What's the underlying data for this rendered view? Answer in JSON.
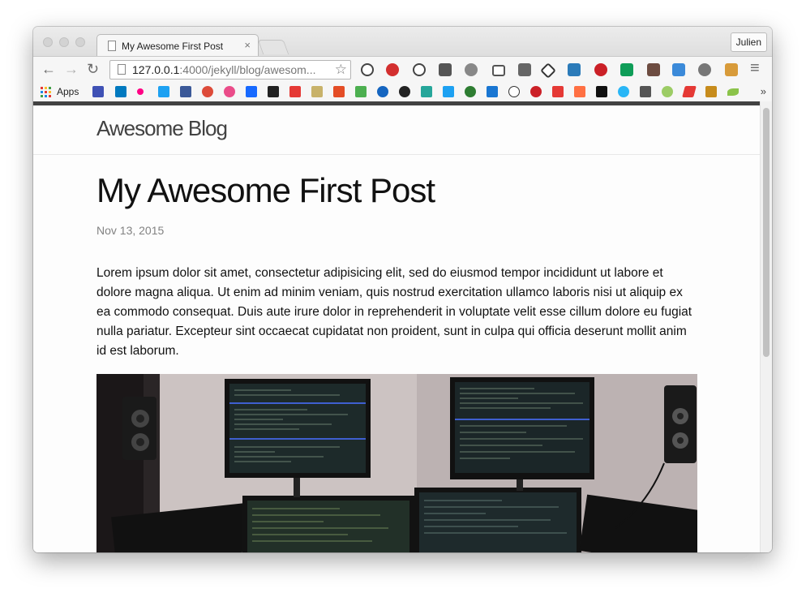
{
  "browser": {
    "tab_title": "My Awesome First Post",
    "tab_close": "×",
    "profile": "Julien",
    "url_host": "127.0.0.1",
    "url_rest": ":4000/jekyll/blog/awesom...",
    "back": "←",
    "forward": "→",
    "reload": "↻",
    "star": "☆",
    "menu": "≡",
    "bookmarks_apps": "Apps",
    "bookmarks_more": "»"
  },
  "page": {
    "site_title": "Awesome Blog",
    "post_title": "My Awesome First Post",
    "post_date": "Nov 13, 2015",
    "post_body": "Lorem ipsum dolor sit amet, consectetur adipisicing elit, sed do eiusmod tempor incididunt ut labore et dolore magna aliqua. Ut enim ad minim veniam, quis nostrud exercitation ullamco laboris nisi ut aliquip ex ea commodo consequat. Duis aute irure dolor in reprehenderit in voluptate velit esse cillum dolore eu fugiat nulla pariatur. Excepteur sint occaecat cupidatat non proident, sunt in culpa qui officia deserunt mollit anim id est laborum."
  },
  "colors": {
    "header_bar": "#424242",
    "text": "#111111",
    "date": "#828282"
  }
}
